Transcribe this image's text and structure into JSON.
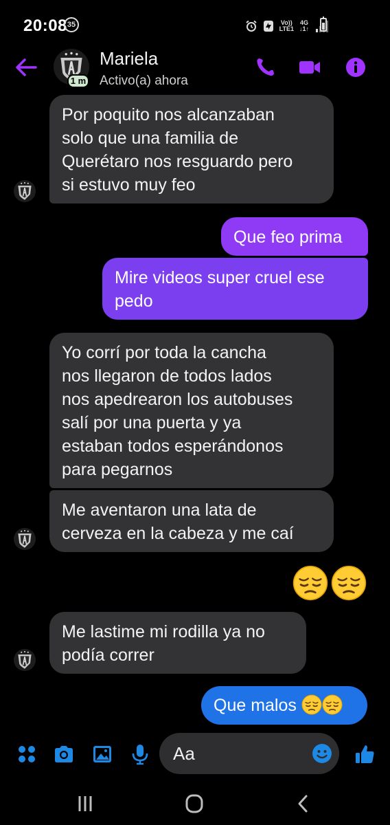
{
  "status_bar": {
    "time": "20:08",
    "notification_count": "35",
    "volte_line1": "Vo))",
    "volte_line2": "LTE1",
    "network_line1": "4G",
    "network_line2": "↓1↑"
  },
  "header": {
    "contact_name": "Mariela",
    "contact_status": "Activo(a) ahora",
    "active_badge": "1 m"
  },
  "composer": {
    "placeholder": "Aa"
  },
  "colors": {
    "accent_purple": "#a033ff",
    "incoming_bubble": "#333335",
    "outgoing_purple": "#8a3cf3",
    "outgoing_blue": "#1f73e6",
    "composer_blue": "#1e88e5"
  },
  "icons": {
    "header": [
      "back-arrow-icon",
      "phone-icon",
      "video-camera-icon",
      "info-icon"
    ],
    "composer": [
      "apps-grid-icon",
      "camera-icon",
      "gallery-icon",
      "microphone-icon",
      "emoji-icon",
      "thumbs-up-icon"
    ],
    "navigation": [
      "recent-apps-icon",
      "home-icon",
      "back-icon"
    ]
  },
  "messages": [
    {
      "direction": "incoming",
      "lines": [
        "Por poquito nos alcanzaban",
        "solo que una familia de",
        "Querétaro nos resguardo pero",
        "si estuvo muy feo"
      ]
    },
    {
      "direction": "outgoing",
      "lines": [
        "Que feo prima"
      ]
    },
    {
      "direction": "outgoing",
      "lines": [
        "Mire videos super cruel ese",
        "pedo"
      ]
    },
    {
      "direction": "incoming",
      "lines": [
        "Yo corrí por toda la cancha",
        "nos llegaron de todos lados",
        "nos apedrearon los autobuses",
        "salí por una puerta y ya",
        "estaban todos esperándonos",
        "para pegarnos"
      ]
    },
    {
      "direction": "incoming",
      "lines": [
        "Me aventaron una lata de",
        "cerveza en la cabeza y me caí"
      ]
    },
    {
      "direction": "outgoing",
      "type": "emoji",
      "emoji": [
        "pensive-face",
        "pensive-face"
      ]
    },
    {
      "direction": "incoming",
      "lines": [
        "Me lastime mi rodilla ya no",
        "podía correr"
      ]
    },
    {
      "direction": "outgoing",
      "text": "Que malos",
      "emoji": [
        "pensive-face",
        "pensive-face"
      ]
    }
  ]
}
